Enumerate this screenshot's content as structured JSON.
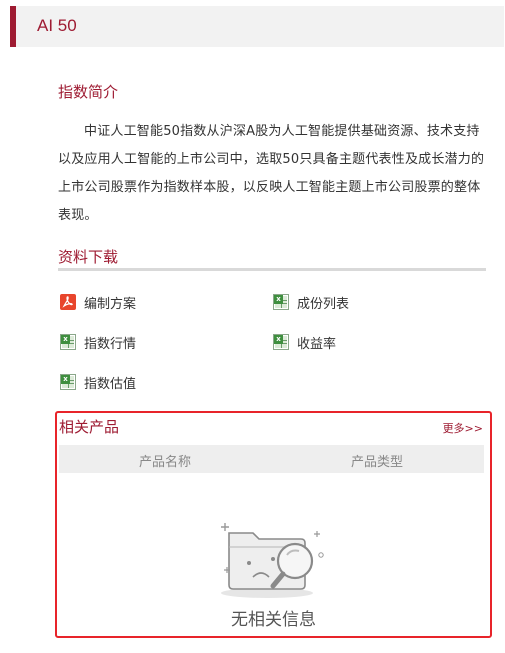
{
  "header": {
    "title": "AI 50"
  },
  "intro": {
    "heading": "指数简介",
    "text": "中证人工智能50指数从沪深A股为人工智能提供基础资源、技术支持以及应用人工智能的上市公司中，选取50只具备主题代表性及成长潜力的上市公司股票作为指数样本股，以反映人工智能主题上市公司股票的整体表现。"
  },
  "downloads": {
    "heading": "资料下载",
    "items": [
      {
        "label": "编制方案",
        "icon": "pdf-icon"
      },
      {
        "label": "成份列表",
        "icon": "excel-icon"
      },
      {
        "label": "指数行情",
        "icon": "excel-icon"
      },
      {
        "label": "收益率",
        "icon": "excel-icon"
      },
      {
        "label": "指数估值",
        "icon": "excel-icon"
      }
    ]
  },
  "related": {
    "heading": "相关产品",
    "more": "更多>>",
    "columns": [
      "产品名称",
      "产品类型"
    ],
    "empty_text": "无相关信息"
  },
  "colors": {
    "accent": "#9e1b32",
    "highlight_border": "#e8242a"
  }
}
